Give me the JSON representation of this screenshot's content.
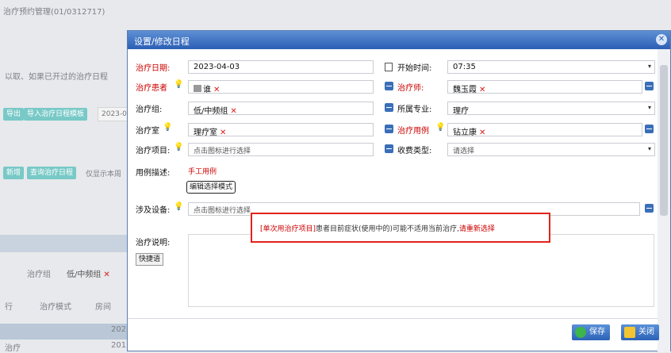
{
  "background": {
    "top_title": "治疗预约管理(01/0312717)",
    "desc": "以取、如果已开过的治疗日程",
    "btn1": "导出",
    "btn2": "导入治疗日程模板",
    "small1": "2023-0",
    "btn3": "新增",
    "btn4": "查询治疗日程",
    "note": "仅显示本周",
    "row_label1": "治疗组",
    "row_value1": "低/中频组",
    "col1": "行",
    "col2": "治疗模式",
    "col3": "房间",
    "bottom_num": "202",
    "bottom_num2": "201",
    "bottom_left": "治疗"
  },
  "modal": {
    "title": "设置/修改日程",
    "close_icon": "close-icon",
    "fields": {
      "date_label": "治疗日期:",
      "date_value": "2023-04-03",
      "start_label": "开始时间:",
      "start_value": "07:35",
      "patient_label": "治疗患者",
      "patient_value": "谁",
      "therapist_label": "治疗师:",
      "therapist_value": "魏玉霞",
      "group_label": "治疗组:",
      "group_value": "低/中频组",
      "specialty_label": "所属专业:",
      "specialty_value": "理疗",
      "room_label": "治疗室",
      "room_value": "理疗室",
      "case_label": "治疗用例",
      "case_value": "钻立康",
      "item_label": "治疗项目:",
      "item_placeholder": "点击图标进行选择",
      "fee_label": "收费类型:",
      "fee_placeholder": "请选择",
      "case_desc_label": "用例描述:",
      "case_desc_value": "手工用例",
      "mode_btn": "编辑选择模式",
      "equip_label": "涉及设备:",
      "equip_placeholder": "点击图标进行选择",
      "note_label": "治疗说明:",
      "quick_btn": "快捷语"
    },
    "warning": {
      "part1": "[单次用治疗项目]",
      "part2": "患者目前症状(使用中的)可能不适用当前治疗,",
      "part3": "请重新选择"
    },
    "buttons": {
      "save": "保存",
      "close": "关闭"
    }
  },
  "colors": {
    "title_bar": "#2b5fb5",
    "required": "#cc0000",
    "warning_border": "#e2231a",
    "bg_button": "#78c9c7"
  }
}
